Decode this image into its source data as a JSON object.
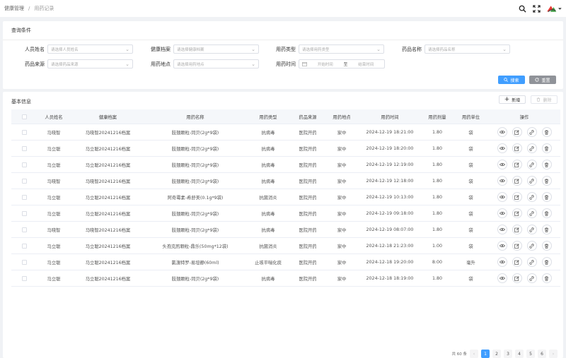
{
  "breadcrumb": {
    "parent": "健康管理",
    "separator": "/",
    "current": "用药记录"
  },
  "query": {
    "title": "查询条件",
    "person_name": {
      "label": "人员姓名",
      "placeholder": "请选择人员姓名"
    },
    "health_record": {
      "label": "健康档案",
      "placeholder": "请选择健康档案"
    },
    "drug_type": {
      "label": "用药类型",
      "placeholder": "请选择用药类型"
    },
    "drug_name": {
      "label": "药品名称",
      "placeholder": "请选择药品名称"
    },
    "drug_source": {
      "label": "药品来源",
      "placeholder": "请选择药品来源"
    },
    "drug_place": {
      "label": "用药地点",
      "placeholder": "请选择用药地点"
    },
    "drug_time": {
      "label": "用药时间",
      "start_placeholder": "开始时间",
      "to": "至",
      "end_placeholder": "结束时间"
    },
    "search_label": "搜索",
    "reset_label": "重置"
  },
  "info": {
    "title": "基本信息",
    "add_label": "新增",
    "delete_label": "删除"
  },
  "table": {
    "headers": [
      "人员姓名",
      "健康档案",
      "用药名称",
      "用药类型",
      "药品来源",
      "用药地点",
      "用药时间",
      "用药剂量",
      "用药单位",
      "操作"
    ],
    "rows": [
      [
        "马晓智",
        "马晓智20241216档案",
        "肢翘颗粒-同贝(2g*9袋)",
        "抗病毒",
        "医院开药",
        "家中",
        "2024-12-19 18:21:00",
        "1.80",
        "袋"
      ],
      [
        "马立聪",
        "马立聪20241216档案",
        "肢翘颗粒-同贝(2g*9袋)",
        "抗病毒",
        "医院开药",
        "家中",
        "2024-12-19 18:20:00",
        "1.80",
        "袋"
      ],
      [
        "马立聪",
        "马立聪20241216档案",
        "肢翘颗粒-同贝(2g*9袋)",
        "抗病毒",
        "医院开药",
        "家中",
        "2024-12-19 12:19:00",
        "1.80",
        "袋"
      ],
      [
        "马晓智",
        "马晓智20241216档案",
        "肢翘颗粒-同贝(2g*9袋)",
        "抗病毒",
        "医院开药",
        "家中",
        "2024-12-19 12:18:00",
        "1.80",
        "袋"
      ],
      [
        "马立聪",
        "马立聪20241216档案",
        "阿奇霉素-希舒美(0.1g*9袋)",
        "抗菌消炎",
        "医院开药",
        "家中",
        "2024-12-19 10:13:00",
        "1.80",
        "袋"
      ],
      [
        "马立聪",
        "马立聪20241216档案",
        "肢翘颗粒-同贝(2g*9袋)",
        "抗病毒",
        "医院开药",
        "家中",
        "2024-12-19 09:18:00",
        "1.80",
        "袋"
      ],
      [
        "马晓智",
        "马晓智20241216档案",
        "肢翘颗粒-同贝(2g*9袋)",
        "抗病毒",
        "医院开药",
        "家中",
        "2024-12-19 08:07:00",
        "1.80",
        "袋"
      ],
      [
        "马立聪",
        "马立聪20241216档案",
        "头孢克肟颗粒-鼎乐(50mg*12袋)",
        "抗菌消炎",
        "医院开药",
        "家中",
        "2024-12-18 21:23:00",
        "1.00",
        "袋"
      ],
      [
        "马立聪",
        "马立聪20241216档案",
        "氯溴特罗-易坦静(60ml)",
        "止咳平喘化痰",
        "医院开药",
        "家中",
        "2024-12-18 19:20:00",
        "8:00",
        "毫升"
      ],
      [
        "马立聪",
        "马立聪20241216档案",
        "肢翘颗粒-同贝(2g*9袋)",
        "抗病毒",
        "医院开药",
        "家中",
        "2024-12-18 18:19:00",
        "1.80",
        "袋"
      ]
    ]
  },
  "pagination": {
    "total": "共 60 条",
    "pages": [
      "1",
      "2",
      "3",
      "4",
      "5",
      "6"
    ],
    "current": "1"
  },
  "icons": {
    "search": "search-icon",
    "fullscreen": "fullscreen-icon",
    "logo": "app-logo",
    "view": "eye-icon",
    "edit": "edit-icon",
    "link": "link-icon",
    "delete": "trash-icon"
  },
  "colors": {
    "primary": "#409eff",
    "reset": "#909399",
    "logo_red": "#e53935",
    "logo_green": "#43a047"
  }
}
